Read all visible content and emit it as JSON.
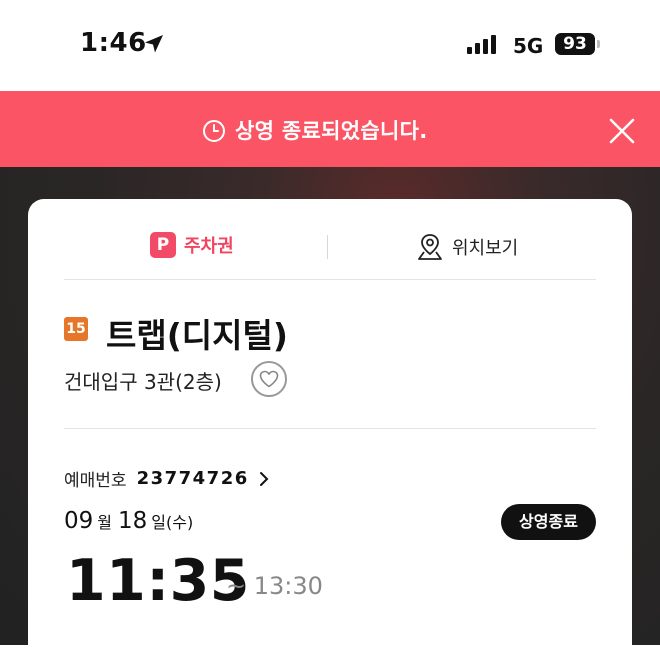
{
  "status_bar": {
    "time": "1:46",
    "network": "5G",
    "battery": "93"
  },
  "banner": {
    "message": "상영 종료되었습니다."
  },
  "tabs": {
    "parking": "주차권",
    "parking_badge": "P",
    "location": "위치보기"
  },
  "movie": {
    "rating": "15",
    "title": "트랩(디지털)",
    "venue": "건대입구 3관(2층)"
  },
  "booking": {
    "label": "예매번호",
    "number": "23774726"
  },
  "schedule": {
    "month": "09",
    "month_unit": "월",
    "day": "18",
    "day_unit": "일(수)",
    "status": "상영종료",
    "start": "11:35",
    "end": "~ 13:30"
  },
  "colors": {
    "banner": "#fb5565",
    "accent": "#f0455f",
    "rating": "#e6762a"
  }
}
